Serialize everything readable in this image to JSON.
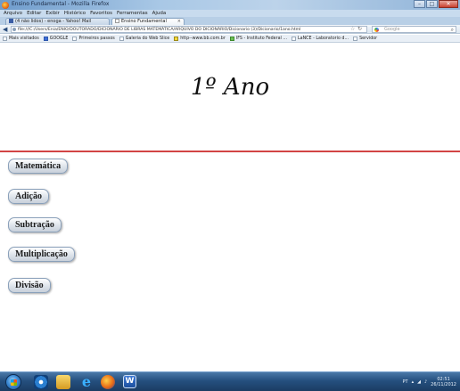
{
  "window": {
    "title": "Ensino Fundamental - Mozilla Firefox",
    "controls": [
      "–",
      "□",
      "✕"
    ]
  },
  "menu": [
    "Arquivo",
    "Editar",
    "Exibir",
    "Histórico",
    "Favoritos",
    "Ferramentas",
    "Ajuda"
  ],
  "tabs": [
    {
      "label": "(4 não lidos) - enoga - Yahoo! Mail"
    },
    {
      "label": "Ensino Fundamental"
    }
  ],
  "navigation": {
    "url": "file:///C:/Users/Enia/ENIO/DOUTORADO/DICIONÁRIO DE LIBRAS MATEMÁTICA/ARQUIVO DO DICIONÁRIO/Dicionario (3)/Dicionario/1ano.html",
    "search_placeholder": "Google"
  },
  "bookmarks": [
    {
      "label": "Mais visitados",
      "icon": "bookmark-icon"
    },
    {
      "label": "GOOGLE",
      "icon": "google-icon"
    },
    {
      "label": "Primeiros passos",
      "icon": "page-icon"
    },
    {
      "label": "Galeria do Web Slice",
      "icon": "page-icon"
    },
    {
      "label": "http--www.bb.com.br",
      "icon": "bb-icon"
    },
    {
      "label": "IFS - Instituto Federal ...",
      "icon": "ifs-icon"
    },
    {
      "label": "LaNCE - Laboratorio d...",
      "icon": "page-icon"
    },
    {
      "label": "Servidor",
      "icon": "page-icon"
    }
  ],
  "page": {
    "heading": "1º Ano",
    "buttons": [
      {
        "label": "Matemática"
      },
      {
        "label": "Adição"
      },
      {
        "label": "Subtração"
      },
      {
        "label": "Multiplicação"
      },
      {
        "label": "Divisão"
      }
    ]
  },
  "taskbar": {
    "lang": "PT",
    "time": "02:51",
    "date": "26/11/2012"
  }
}
